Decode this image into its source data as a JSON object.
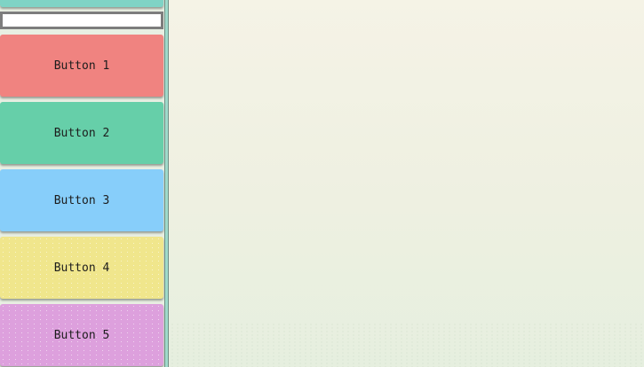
{
  "sidebar": {
    "input": {
      "value": "",
      "placeholder": ""
    },
    "buttons": [
      {
        "label": "Button 1",
        "color": "#f08380"
      },
      {
        "label": "Button 2",
        "color": "#66cfa9"
      },
      {
        "label": "Button 3",
        "color": "#87cefa"
      },
      {
        "label": "Button 4",
        "color": "#f0e68c"
      },
      {
        "label": "Button 5",
        "color": "#dda0dd"
      }
    ],
    "top_button_color": "#7fd3c5",
    "edge_color": "#9fdacb"
  },
  "main": {
    "background_top": "#f5f3e6",
    "background_bottom": "#e6efdf"
  }
}
